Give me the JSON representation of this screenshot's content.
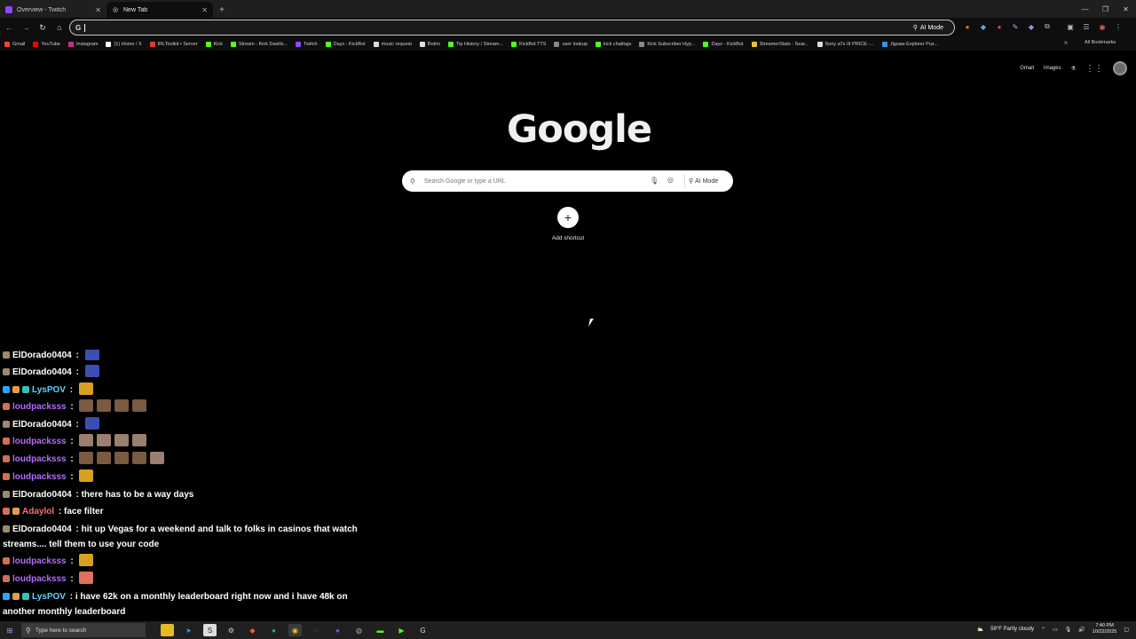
{
  "browser": {
    "tabs": [
      {
        "title": "Overview - Twitch",
        "active": false,
        "favicon_color": "#9146ff"
      },
      {
        "title": "New Tab",
        "active": true,
        "favicon_color": "#dddddd"
      }
    ],
    "omnibox": {
      "prefix": "G",
      "value": "",
      "ai_mode_label": "AI Mode"
    },
    "bookmarks": [
      {
        "label": "Gmail",
        "color": "#ea4335"
      },
      {
        "label": "YouTube",
        "color": "#ff0000"
      },
      {
        "label": "Instagram",
        "color": "#c13584"
      },
      {
        "label": "(1) Home / X",
        "color": "#ffffff"
      },
      {
        "label": "IRLToolkit • Server",
        "color": "#e53935"
      },
      {
        "label": "Kick",
        "color": "#53fc18"
      },
      {
        "label": "Stream - Kick Dashb...",
        "color": "#53fc18"
      },
      {
        "label": "Twitch",
        "color": "#9146ff"
      },
      {
        "label": "Days - KickBot",
        "color": "#53fc18"
      },
      {
        "label": "music request",
        "color": "#dddddd"
      },
      {
        "label": "Botrix",
        "color": "#dddddd"
      },
      {
        "label": "Tip History / Stream...",
        "color": "#53fc18"
      },
      {
        "label": "KickBot TTS",
        "color": "#53fc18"
      },
      {
        "label": "user lookup",
        "color": "#888888"
      },
      {
        "label": "kick chatlogs",
        "color": "#53fc18"
      },
      {
        "label": "Kick Subscriber Hyp...",
        "color": "#888888"
      },
      {
        "label": "Days - KickBot",
        "color": "#53fc18"
      },
      {
        "label": "StreamerStats - Sear...",
        "color": "#f0c040"
      },
      {
        "label": "Sony a7s III PRICE -...",
        "color": "#dddddd"
      },
      {
        "label": "Jigsaw Explorer Puz...",
        "color": "#3a8ee6"
      }
    ],
    "bookmarks_more": "»",
    "all_bookmarks": "All Bookmarks"
  },
  "google": {
    "top_links": {
      "gmail": "Gmail",
      "images": "Images"
    },
    "logo": "Google",
    "search_placeholder": "Search Google or type a URL",
    "ai_mode_label": "AI Mode",
    "add_shortcut_label": "Add shortcut",
    "add_shortcut_icon": "+"
  },
  "chat": {
    "messages": [
      {
        "user": "ElDorado0404",
        "color": "#ffffff",
        "badges": [
          "#9b8a6a"
        ],
        "text": "",
        "emotes": [
          "#3b4fb0"
        ]
      },
      {
        "user": "ElDorado0404",
        "color": "#ffffff",
        "badges": [
          "#9b8a6a"
        ],
        "text": "",
        "emotes": [
          "#3b4fb0"
        ]
      },
      {
        "user": "LysPOV",
        "color": "#5fd3ff",
        "badges": [
          "#2aa6ff",
          "#e0a040",
          "#2ec4b6"
        ],
        "text": "",
        "emotes": [
          "#d8a020"
        ]
      },
      {
        "user": "loudpacksss",
        "color": "#b36bff",
        "badges": [
          "#d07050"
        ],
        "text": "",
        "emotes": [
          "#7a5a40",
          "#7a5a40",
          "#7a5a40",
          "#7a5a40"
        ]
      },
      {
        "user": "ElDorado0404",
        "color": "#ffffff",
        "badges": [
          "#9b8a6a"
        ],
        "text": "",
        "emotes": [
          "#3b4fb0"
        ]
      },
      {
        "user": "loudpacksss",
        "color": "#b36bff",
        "badges": [
          "#d07050"
        ],
        "text": "",
        "emotes": [
          "#9a8070",
          "#9a8070",
          "#9a8070",
          "#9a8070"
        ]
      },
      {
        "user": "loudpacksss",
        "color": "#b36bff",
        "badges": [
          "#d07050"
        ],
        "text": "",
        "emotes": [
          "#7a5a40",
          "#7a5a40",
          "#7a5a40",
          "#7a5a40",
          "#9a8070"
        ]
      },
      {
        "user": "loudpacksss",
        "color": "#b36bff",
        "badges": [
          "#d07050"
        ],
        "text": "",
        "emotes": [
          "#d8a020"
        ]
      },
      {
        "user": "ElDorado0404",
        "color": "#ffffff",
        "badges": [
          "#9b8a6a"
        ],
        "text": "there has to be a way days",
        "emotes": []
      },
      {
        "user": "Adaylol",
        "color": "#ff6f6f",
        "badges": [
          "#d07050",
          "#e0a040"
        ],
        "text": "face filter",
        "emotes": []
      },
      {
        "user": "ElDorado0404",
        "color": "#ffffff",
        "badges": [
          "#9b8a6a"
        ],
        "text": "hit up Vegas for a weekend and talk to folks in casinos that watch streams.... tell them to use your code",
        "emotes": []
      },
      {
        "user": "loudpacksss",
        "color": "#b36bff",
        "badges": [
          "#d07050"
        ],
        "text": "",
        "emotes": [
          "#d8a020"
        ]
      },
      {
        "user": "loudpacksss",
        "color": "#b36bff",
        "badges": [
          "#d07050"
        ],
        "text": "",
        "emotes": [
          "#e07060"
        ]
      },
      {
        "user": "LysPOV",
        "color": "#5fd3ff",
        "badges": [
          "#2aa6ff",
          "#e0a040",
          "#2ec4b6"
        ],
        "text": "i have 62k on a monthly leaderboard right now and i have 48k on another monthly leaderboard",
        "emotes": []
      }
    ]
  },
  "taskbar": {
    "search_placeholder": "Type here to search",
    "weather": "59°F  Partly cloudy",
    "time": "7:40 PM",
    "date": "10/22/2025"
  }
}
